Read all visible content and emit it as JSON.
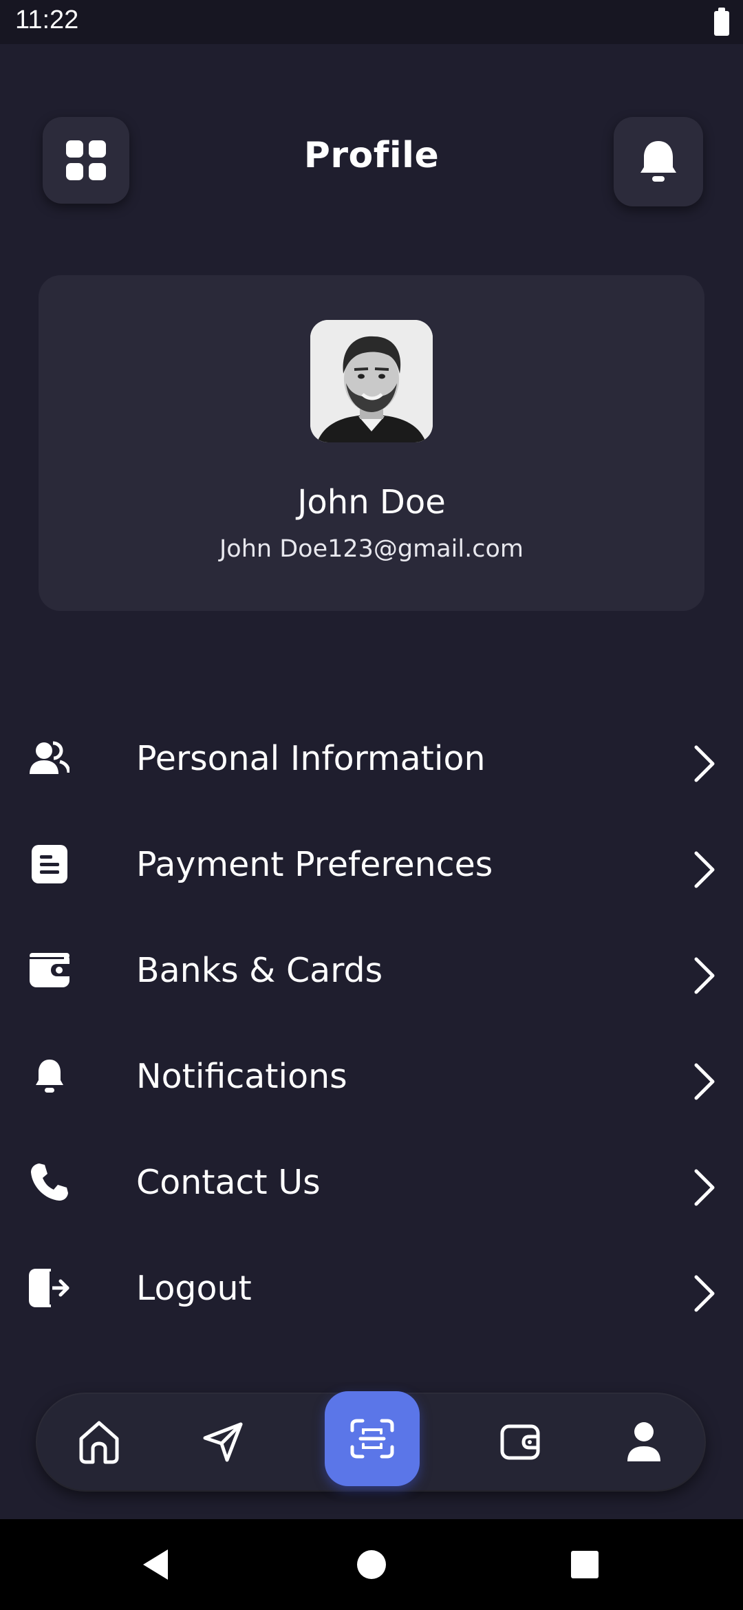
{
  "status_bar": {
    "time": "11:22"
  },
  "header": {
    "title": "Profile",
    "menu_icon": "grid-icon",
    "notification_icon": "bell-icon"
  },
  "profile": {
    "name": "John Doe",
    "email": "John Doe123@gmail.com"
  },
  "menu": [
    {
      "label": "Personal Information",
      "icon": "users-icon"
    },
    {
      "label": "Payment Preferences",
      "icon": "document-icon"
    },
    {
      "label": "Banks & Cards",
      "icon": "wallet-icon"
    },
    {
      "label": "Notifications",
      "icon": "bell-icon"
    },
    {
      "label": "Contact Us",
      "icon": "phone-icon"
    },
    {
      "label": "Logout",
      "icon": "logout-icon"
    }
  ],
  "bottom_nav": {
    "items": [
      "home-icon",
      "send-icon",
      "scan-icon",
      "wallet-icon",
      "user-icon"
    ],
    "active": "scan-icon"
  },
  "colors": {
    "background": "#1f1e2e",
    "card": "#2a2939",
    "accent": "#5b76e8",
    "text": "#ffffff"
  }
}
